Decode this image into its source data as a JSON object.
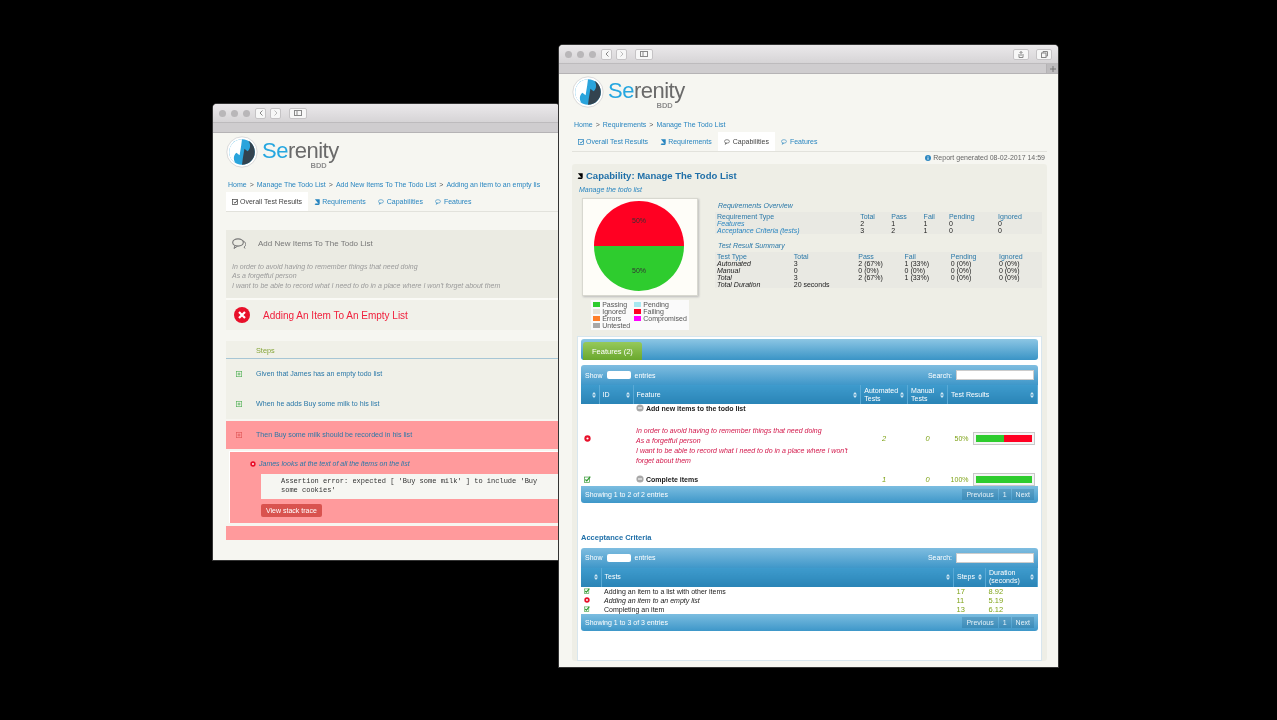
{
  "back_window": {
    "logo": {
      "accent": "Se",
      "rest": "renity",
      "sub": "BDD"
    },
    "breadcrumb": [
      {
        "kind": "link",
        "text": "Home"
      },
      {
        "kind": "separator",
        "text": ">"
      },
      {
        "kind": "link",
        "text": "Manage The Todo List"
      },
      {
        "kind": "separator",
        "text": ">"
      },
      {
        "kind": "link",
        "text": "Add New Items To The Todo List"
      },
      {
        "kind": "separator",
        "text": ">"
      },
      {
        "kind": "link",
        "text": "Adding an item to an empty lis"
      }
    ],
    "tabs": [
      {
        "label": "Overall Test Results",
        "selected": true
      },
      {
        "label": "Requirements",
        "selected": false
      },
      {
        "label": "Capabilities",
        "selected": false
      },
      {
        "label": "Features",
        "selected": false
      }
    ],
    "story": {
      "title": "Add New Items To The Todo List",
      "narrative": [
        "In order to avoid having to remember things that need doing",
        "As a forgetful person",
        "I want to be able to record what I need to do in a place where I won't forget about them"
      ]
    },
    "scenario": {
      "title": "Adding An Item To An Empty List",
      "failed": true
    },
    "steps_heading": "Steps",
    "steps": [
      {
        "text": "Given that James has an empty todo list",
        "failed": false
      },
      {
        "text": "When he adds Buy some milk to his list",
        "failed": false
      },
      {
        "text": "Then Buy some milk should be recorded in his list",
        "failed": true,
        "children": [
          {
            "text": "James looks at the text of all the items on the list",
            "failed": true,
            "error": "Assertion error: expected [ 'Buy some milk' ] to include 'Buy some cookies'",
            "action": "View stack trace"
          }
        ]
      }
    ]
  },
  "front_window": {
    "logo": {
      "accent": "Se",
      "rest": "renity",
      "sub": "BDD"
    },
    "breadcrumb": [
      {
        "kind": "link",
        "text": "Home"
      },
      {
        "kind": "separator",
        "text": ">"
      },
      {
        "kind": "link",
        "text": "Requirements"
      },
      {
        "kind": "separator",
        "text": ">"
      },
      {
        "kind": "link",
        "text": "Manage The Todo List"
      }
    ],
    "tabs": [
      {
        "label": "Overall Test Results",
        "selected": false
      },
      {
        "label": "Requirements",
        "selected": false
      },
      {
        "label": "Capabilities",
        "selected": true
      },
      {
        "label": "Features",
        "selected": false
      }
    ],
    "report_generated": "Report generated 08-02-2017 14:59",
    "capability": {
      "title": "Capability: Manage The Todo List",
      "description": "Manage the todo list",
      "chart_data": {
        "type": "pie",
        "categories": [
          "Passing",
          "Pending",
          "Ignored",
          "Failing",
          "Errors",
          "Compromised",
          "Untested"
        ],
        "values": [
          50,
          0,
          0,
          50,
          0,
          0,
          0
        ],
        "colors": [
          "#2ecc2e",
          "#a8e8f0",
          "#e4e3da",
          "#ff0022",
          "#ff7f2a",
          "#ff00ff",
          "#a8a8a8"
        ],
        "value_labels": [
          "50%",
          null,
          null,
          "50%",
          null,
          null,
          null
        ]
      },
      "requirements_overview": {
        "title": "Requirements Overview",
        "columns": [
          "Requirement Type",
          "Total",
          "Pass",
          "Fail",
          "Pending",
          "Ignored"
        ],
        "rows": [
          [
            "Features",
            "2",
            "1",
            "1",
            "0",
            "0"
          ],
          [
            "Acceptance Criteria (tests)",
            "3",
            "2",
            "1",
            "0",
            "0"
          ]
        ]
      },
      "test_result_summary": {
        "title": "Test Result Summary",
        "columns": [
          "Test Type",
          "Total",
          "Pass",
          "Fail",
          "Pending",
          "Ignored"
        ],
        "rows": [
          [
            "Automated",
            "3",
            "2 (67%)",
            "1 (33%)",
            "0 (0%)",
            "0 (0%)"
          ],
          [
            "Manual",
            "0",
            "0 (0%)",
            "0 (0%)",
            "0 (0%)",
            "0 (0%)"
          ],
          [
            "Total",
            "3",
            "2 (67%)",
            "1 (33%)",
            "0 (0%)",
            "0 (0%)"
          ],
          [
            "Total Duration",
            "20 seconds"
          ]
        ]
      }
    },
    "features": {
      "tab": "Features (2)",
      "show_label": "Show",
      "entries_label": "entries",
      "search_label": "Search:",
      "columns": [
        "",
        "ID",
        "Feature",
        "Automated Tests",
        "Manual Tests",
        "Test Results"
      ],
      "rows": [
        {
          "failed": true,
          "title": "Add new items to the todo list",
          "narrative": [
            "In order to avoid having to remember things that need doing",
            "As a forgetful person",
            "I want to be able to record what I need to do in a place where I won't forget about them"
          ],
          "automated": "2",
          "manual": "0",
          "percent": "50%",
          "level": 0.5
        },
        {
          "failed": false,
          "title": "Complete items",
          "automated": "1",
          "manual": "0",
          "percent": "100%",
          "level": 1
        }
      ],
      "info": "Showing 1 to 2 of 2 entries",
      "pager": [
        {
          "label": "Previous",
          "disabled": true
        },
        {
          "label": "1",
          "disabled": true
        },
        {
          "label": "Next",
          "disabled": true
        }
      ]
    },
    "acceptance_criteria": {
      "title": "Acceptance Criteria",
      "show_label": "Show",
      "entries_label": "entries",
      "search_label": "Search:",
      "columns": [
        "",
        "Tests",
        "Steps",
        "Duration (seconds)"
      ],
      "rows": [
        {
          "failed": false,
          "name": "Adding an item to a list with other items",
          "steps": "17",
          "duration": "8.92"
        },
        {
          "failed": true,
          "name": "Adding an item to an empty list",
          "steps": "11",
          "duration": "5.19"
        },
        {
          "failed": false,
          "name": "Completing an item",
          "steps": "13",
          "duration": "6.12"
        }
      ],
      "info": "Showing 1 to 3 of 3 entries",
      "pager": [
        {
          "label": "Previous",
          "disabled": true
        },
        {
          "label": "1",
          "disabled": true
        },
        {
          "label": "Next",
          "disabled": true
        }
      ]
    }
  }
}
